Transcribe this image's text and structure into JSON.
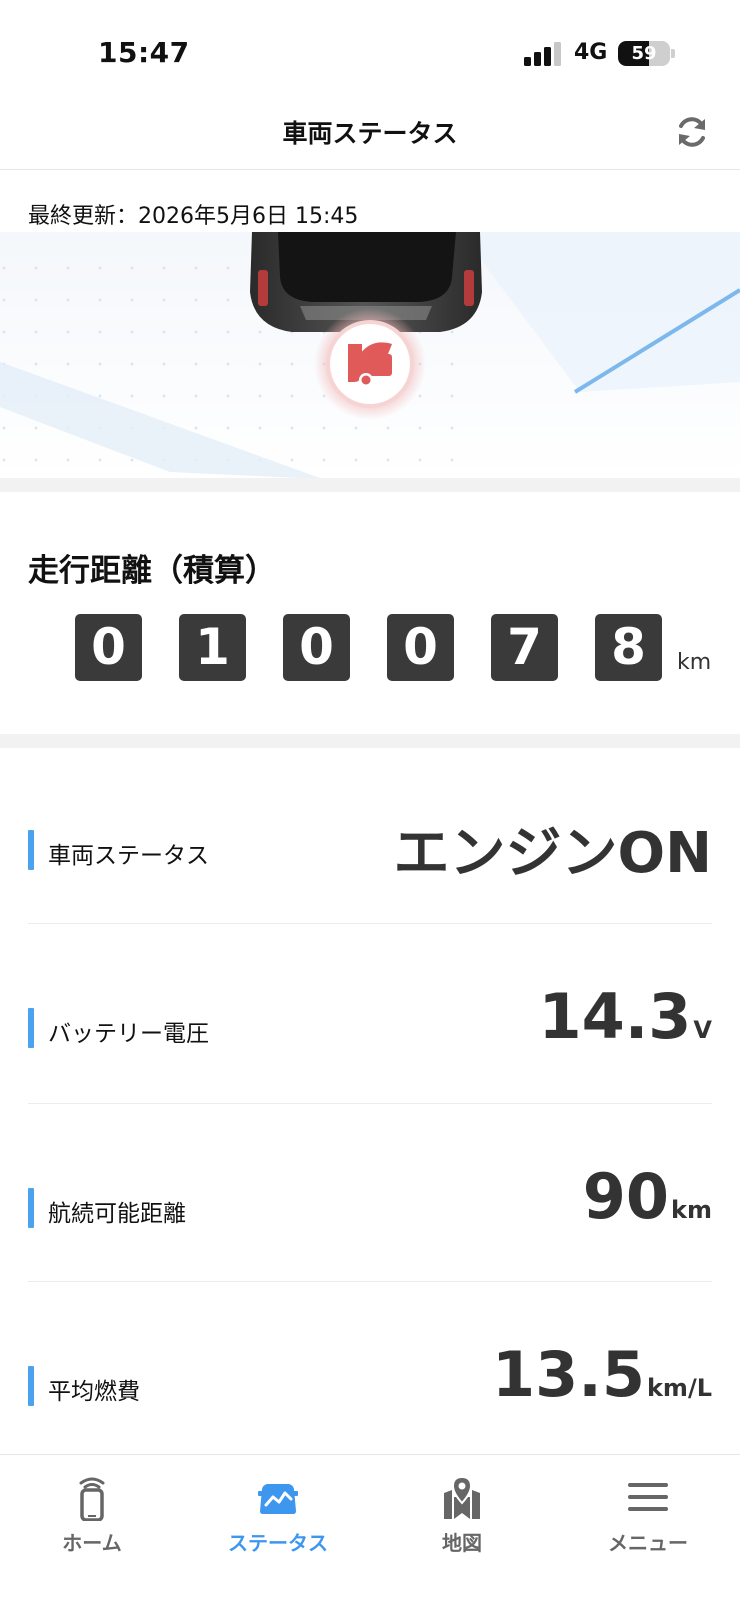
{
  "status_bar": {
    "time": "15:47",
    "network": "4G",
    "battery_percent": "59",
    "battery_level": 0.59,
    "signal_bars_active": 3,
    "signal_bars_total": 4
  },
  "header": {
    "title": "車両ステータス",
    "refresh_icon": "refresh-icon"
  },
  "last_updated": "最終更新：2026年5月6日 15:45",
  "odometer": {
    "title": "走行距離（積算）",
    "digits": [
      "0",
      "1",
      "0",
      "0",
      "7",
      "8"
    ],
    "unit": "km"
  },
  "rows": [
    {
      "label": "車両ステータス",
      "value": "エンジンON",
      "unit": ""
    },
    {
      "label": "バッテリー電圧",
      "value": "14.3",
      "unit": "V"
    },
    {
      "label": "航続可能距離",
      "value": "90",
      "unit": "km"
    },
    {
      "label": "平均燃費",
      "value": "13.5",
      "unit": "km/L"
    }
  ],
  "tabs": [
    {
      "label": "ホーム",
      "icon": "smartphone-icon",
      "active": false
    },
    {
      "label": "ステータス",
      "icon": "car-status-icon",
      "active": true
    },
    {
      "label": "地図",
      "icon": "map-pin-icon",
      "active": false
    },
    {
      "label": "メニュー",
      "icon": "menu-icon",
      "active": false
    }
  ],
  "colors": {
    "accent": "#4ba3f0",
    "active_tab": "#3e97ee",
    "alert_red": "#e05a5a",
    "digit_bg": "#3a3a3a"
  },
  "alert_icon": "trunk-open-icon"
}
